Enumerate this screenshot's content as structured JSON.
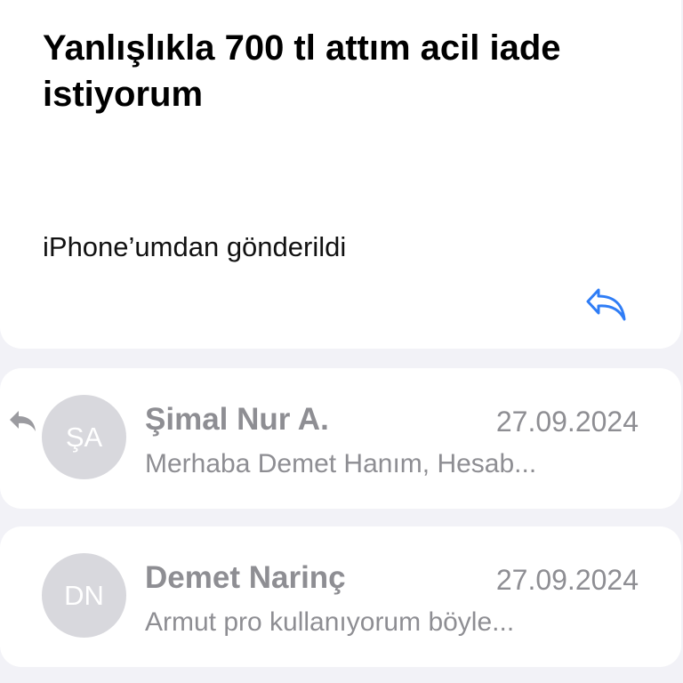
{
  "message": {
    "subject": "Yanlışlıkla 700 tl attım acil iade istiyorum",
    "body": "iPhone’umdan gönderildi",
    "reply_icon": "reply-arrow-icon",
    "accent_color": "#2f7df6"
  },
  "thread": [
    {
      "initials": "ŞA",
      "sender": "Şimal Nur A.",
      "date": "27.09.2024",
      "preview": "Merhaba Demet Hanım, Hesab...",
      "status_icon": "replied-arrow-icon"
    },
    {
      "initials": "DN",
      "sender": "Demet Narinç",
      "date": "27.09.2024",
      "preview": "Armut pro kullanıyorum böyle..."
    }
  ]
}
